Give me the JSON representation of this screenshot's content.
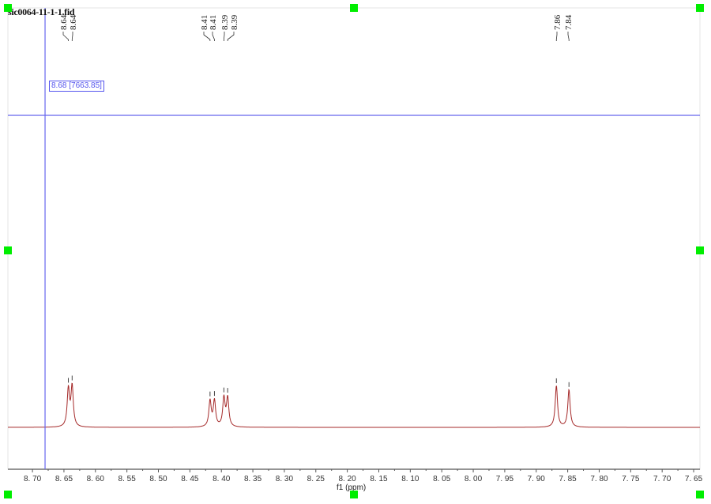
{
  "document": {
    "title": "sic0064-11-1-1.fid"
  },
  "cursor": {
    "ppm": 8.68,
    "readout": "8.68  [7663.85]",
    "intensity": 7663.85
  },
  "colors": {
    "spectrum": "#a52a2a",
    "cursor": "#6666ee",
    "handle": "#00ee00",
    "axis": "#555555"
  },
  "chart_data": {
    "type": "line",
    "title": "sic0064-11-1-1.fid",
    "xlabel": "f1 (ppm)",
    "ylabel": "",
    "xlim": [
      8.739,
      7.64
    ],
    "ylim": [
      -8,
      88
    ],
    "x_reversed": true,
    "grid": false,
    "xticks": [
      "8.70",
      "8.65",
      "8.60",
      "8.55",
      "8.50",
      "8.45",
      "8.40",
      "8.35",
      "8.30",
      "8.25",
      "8.20",
      "8.15",
      "8.10",
      "8.05",
      "8.00",
      "7.95",
      "7.90",
      "7.85",
      "7.80",
      "7.75",
      "7.70",
      "7.65"
    ],
    "peaks": [
      {
        "ppm": 8.643,
        "height": 58,
        "label": "8.64"
      },
      {
        "ppm": 8.637,
        "height": 62,
        "label": "8.64"
      },
      {
        "ppm": 8.418,
        "height": 40,
        "label": "8.41"
      },
      {
        "ppm": 8.411,
        "height": 40,
        "label": "8.41"
      },
      {
        "ppm": 8.396,
        "height": 44,
        "label": "8.39"
      },
      {
        "ppm": 8.39,
        "height": 44,
        "label": "8.39"
      },
      {
        "ppm": 7.868,
        "height": 64,
        "label": "7.86"
      },
      {
        "ppm": 7.848,
        "height": 58,
        "label": "7.84"
      }
    ],
    "linewidth_ppm": 0.0022
  }
}
